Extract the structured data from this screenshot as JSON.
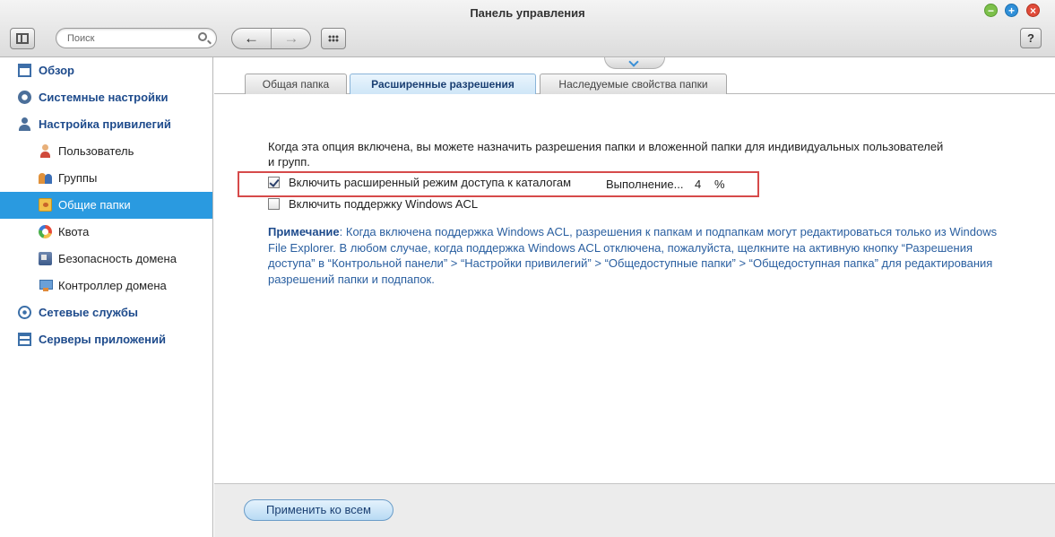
{
  "window": {
    "title": "Панель управления",
    "minimize": "−",
    "maximize": "+",
    "close": "×"
  },
  "toolbar": {
    "search_placeholder": "Поиск",
    "back": "←",
    "forward": "→",
    "help": "?"
  },
  "sidebar": {
    "items": [
      {
        "label": "Обзор",
        "icon": "overview-icon",
        "level": "top"
      },
      {
        "label": "Системные настройки",
        "icon": "gear-icon",
        "level": "top"
      },
      {
        "label": "Настройка привилегий",
        "icon": "privilege-icon",
        "level": "top"
      },
      {
        "label": "Пользователь",
        "icon": "user-icon",
        "level": "sub"
      },
      {
        "label": "Группы",
        "icon": "groups-icon",
        "level": "sub"
      },
      {
        "label": "Общие папки",
        "icon": "shared-folder-icon",
        "level": "sub",
        "active": true
      },
      {
        "label": "Квота",
        "icon": "quota-icon",
        "level": "sub"
      },
      {
        "label": "Безопасность домена",
        "icon": "domain-security-icon",
        "level": "sub"
      },
      {
        "label": "Контроллер домена",
        "icon": "domain-controller-icon",
        "level": "sub"
      },
      {
        "label": "Сетевые службы",
        "icon": "network-icon",
        "level": "top"
      },
      {
        "label": "Серверы приложений",
        "icon": "app-servers-icon",
        "level": "top"
      }
    ]
  },
  "main": {
    "tabs": [
      {
        "label": "Общая папка",
        "active": false
      },
      {
        "label": "Расширенные разрешения",
        "active": true
      },
      {
        "label": "Наследуемые свойства папки",
        "active": false
      }
    ],
    "description": "Когда эта опция включена, вы можете назначить разрешения папки и вложенной папки для индивидуальных пользователей и групп.",
    "advanced_mode": {
      "label": "Включить расширенный режим доступа к каталогам",
      "checked": true,
      "progress_label": "Выполнение...",
      "progress_value": "4",
      "progress_unit": "%"
    },
    "windows_acl": {
      "label": "Включить поддержку Windows ACL",
      "checked": false
    },
    "note": {
      "label": "Примечание",
      "text": ": Когда включена поддержка Windows ACL, разрешения к папкам и подпапкам могут редактироваться только из Windows File Explorer. В любом случае, когда поддержка Windows ACL отключена, пожалуйста, щелкните на активную кнопку “Разрешения доступа” в “Контрольной панели” > “Настройки привилегий” > “Общедоступные папки” > “Общедоступная папка” для редактирования разрешений папки и подпапок."
    },
    "apply_button": "Применить ко всем"
  },
  "colors": {
    "accent": "#2a9ae0",
    "nav_text": "#1e4b8c",
    "note_text": "#2a5fa0",
    "highlight_border": "#d64a4a"
  }
}
